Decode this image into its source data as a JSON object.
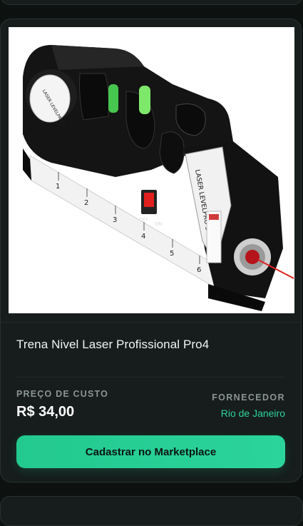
{
  "product": {
    "title": "Trena Nivel Laser Profissional Pro4",
    "image_alt": "product-photo"
  },
  "cost": {
    "label": "PREÇO DE CUSTO",
    "value": "R$ 34,00"
  },
  "supplier": {
    "label": "FORNECEDOR",
    "value": "Rio de Janeiro"
  },
  "actions": {
    "register_label": "Cadastrar no Marketplace"
  },
  "colors": {
    "accent": "#2bd49b",
    "background": "#0d1211",
    "card": "#161d1c"
  },
  "image_text": {
    "brand_left": "LASER LEVELPRO 3",
    "brand_right": "LASER LEVELPRO 3",
    "switch_off": "OFF",
    "switch_on": "ON",
    "ruler_marks": [
      "1",
      "2",
      "3",
      "4",
      "5",
      "6"
    ]
  }
}
